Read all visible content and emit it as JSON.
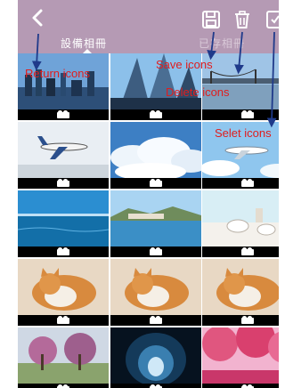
{
  "header": {
    "tabs": [
      {
        "label": "設備相冊",
        "active": true
      },
      {
        "label": "已存相冊",
        "active": false
      }
    ],
    "icons": [
      "chevron-left-icon",
      "save-icon",
      "trash-icon",
      "select-icon"
    ],
    "background_color": "#b59ab4"
  },
  "annotations": {
    "return": "Return icons",
    "save": "Save icons",
    "delete": "Delete icons",
    "select": "Selet icons",
    "color": "#e11d1d",
    "arrow_color": "#1f3a8a"
  },
  "grid": {
    "columns": 3,
    "items": [
      {
        "subject": "city-skyline",
        "video": true
      },
      {
        "subject": "skyscrapers",
        "video": true
      },
      {
        "subject": "city-bridge",
        "video": true
      },
      {
        "subject": "airplane",
        "video": true
      },
      {
        "subject": "clouds",
        "video": true
      },
      {
        "subject": "airplane-sky",
        "video": true
      },
      {
        "subject": "ocean",
        "video": true
      },
      {
        "subject": "coastal-town",
        "video": true
      },
      {
        "subject": "tea-table",
        "video": true
      },
      {
        "subject": "cat",
        "video": true
      },
      {
        "subject": "cat",
        "video": true
      },
      {
        "subject": "cat",
        "video": true
      },
      {
        "subject": "park",
        "video": true
      },
      {
        "subject": "tunnel",
        "video": true
      },
      {
        "subject": "pink-trees",
        "video": true
      }
    ]
  }
}
